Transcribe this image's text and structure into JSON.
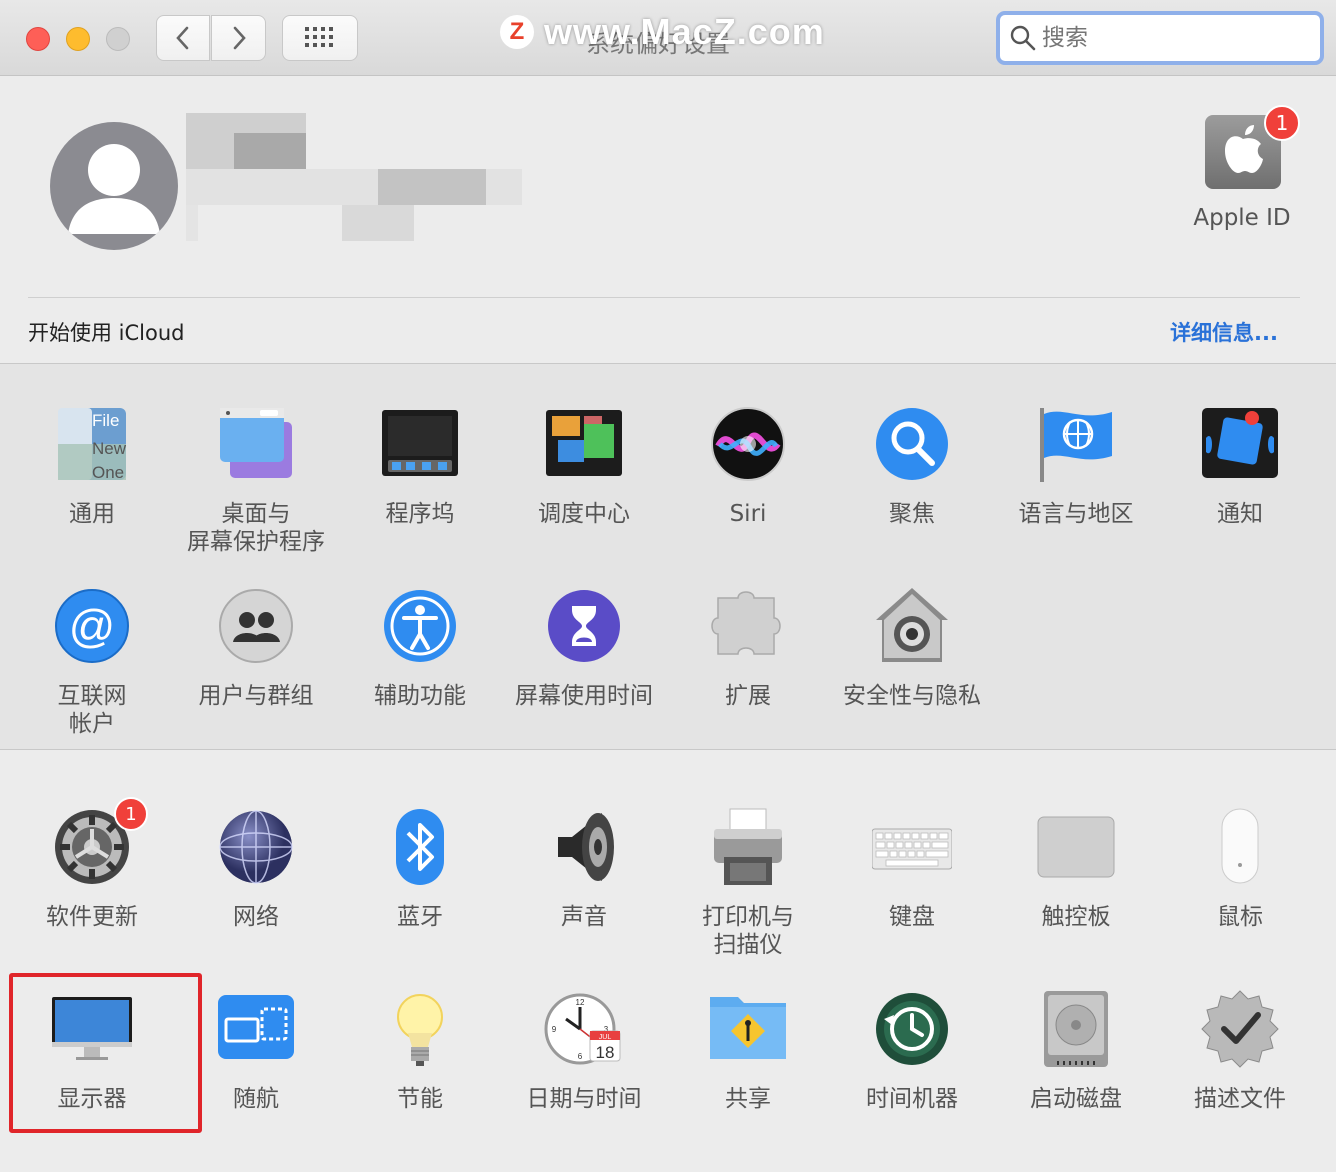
{
  "window": {
    "title": "系统偏好设置",
    "watermark": "www.MacZ.com",
    "watermark_logo": "Z"
  },
  "toolbar": {
    "back": "‹",
    "forward": "›",
    "search_placeholder": "搜索"
  },
  "account": {
    "apple_id_label": "Apple ID",
    "apple_id_badge": "1",
    "icloud_prompt": "开始使用 iCloud",
    "details_link": "详细信息..."
  },
  "section1": [
    {
      "id": "general",
      "label": "通用",
      "icon": "general-icon"
    },
    {
      "id": "desktop",
      "label": "桌面与\n屏幕保护程序",
      "icon": "desktop-screensaver-icon"
    },
    {
      "id": "dock",
      "label": "程序坞",
      "icon": "dock-icon"
    },
    {
      "id": "mission",
      "label": "调度中心",
      "icon": "mission-control-icon"
    },
    {
      "id": "siri",
      "label": "Siri",
      "icon": "siri-icon"
    },
    {
      "id": "spotlight",
      "label": "聚焦",
      "icon": "spotlight-icon"
    },
    {
      "id": "language",
      "label": "语言与地区",
      "icon": "language-region-icon"
    },
    {
      "id": "notifications",
      "label": "通知",
      "icon": "notifications-icon"
    },
    {
      "id": "internet",
      "label": "互联网\n帐户",
      "icon": "internet-accounts-icon"
    },
    {
      "id": "users",
      "label": "用户与群组",
      "icon": "users-groups-icon"
    },
    {
      "id": "accessibility",
      "label": "辅助功能",
      "icon": "accessibility-icon"
    },
    {
      "id": "screentime",
      "label": "屏幕使用时间",
      "icon": "screen-time-icon"
    },
    {
      "id": "extensions",
      "label": "扩展",
      "icon": "extensions-icon"
    },
    {
      "id": "security",
      "label": "安全性与隐私",
      "icon": "security-privacy-icon"
    }
  ],
  "section2": [
    {
      "id": "update",
      "label": "软件更新",
      "icon": "software-update-icon",
      "badge": "1"
    },
    {
      "id": "network",
      "label": "网络",
      "icon": "network-icon"
    },
    {
      "id": "bluetooth",
      "label": "蓝牙",
      "icon": "bluetooth-icon"
    },
    {
      "id": "sound",
      "label": "声音",
      "icon": "sound-icon"
    },
    {
      "id": "printers",
      "label": "打印机与\n扫描仪",
      "icon": "printers-scanners-icon"
    },
    {
      "id": "keyboard",
      "label": "键盘",
      "icon": "keyboard-icon"
    },
    {
      "id": "trackpad",
      "label": "触控板",
      "icon": "trackpad-icon"
    },
    {
      "id": "mouse",
      "label": "鼠标",
      "icon": "mouse-icon"
    },
    {
      "id": "displays",
      "label": "显示器",
      "icon": "display-icon"
    },
    {
      "id": "sidecar",
      "label": "随航",
      "icon": "sidecar-icon"
    },
    {
      "id": "energy",
      "label": "节能",
      "icon": "energy-saver-icon"
    },
    {
      "id": "datetime",
      "label": "日期与时间",
      "icon": "date-time-icon",
      "cal_month": "JUL",
      "cal_day": "18"
    },
    {
      "id": "sharing",
      "label": "共享",
      "icon": "sharing-icon"
    },
    {
      "id": "timemachine",
      "label": "时间机器",
      "icon": "time-machine-icon"
    },
    {
      "id": "startup",
      "label": "启动磁盘",
      "icon": "startup-disk-icon"
    },
    {
      "id": "profiles",
      "label": "描述文件",
      "icon": "profiles-icon"
    }
  ],
  "general_icon_text": [
    "File",
    "New",
    "One"
  ],
  "colors": {
    "highlight": "#e0252a",
    "link": "#2a72d8",
    "badge": "#f0403a"
  }
}
